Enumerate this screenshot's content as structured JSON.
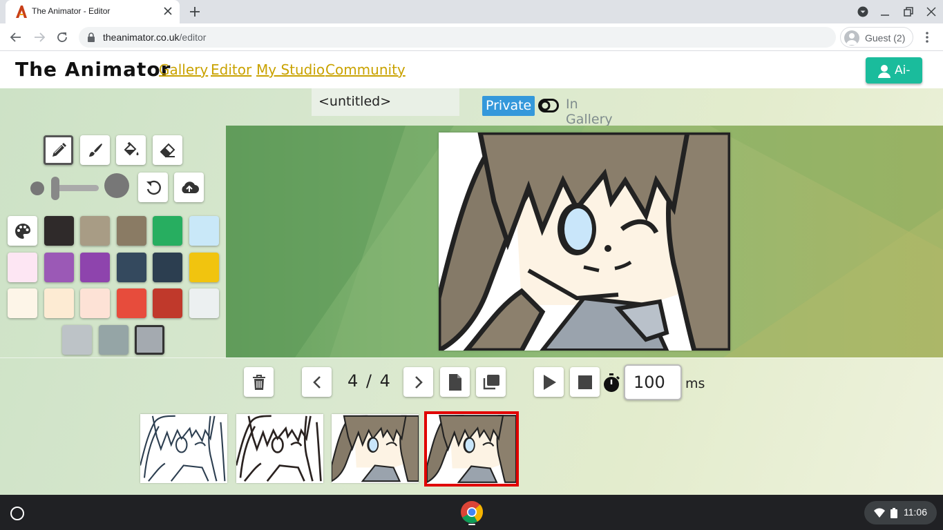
{
  "browser": {
    "tab_title": "The Animator - Editor",
    "url_domain": "theanimator.co.uk",
    "url_path": "/editor",
    "profile_label": "Guest (2)"
  },
  "site": {
    "logo": "The Animator",
    "nav": [
      "Gallery",
      "Editor",
      "My Studio",
      "Community"
    ],
    "user_button": "Ai-"
  },
  "editor": {
    "title": "<untitled>",
    "privacy_private": "Private",
    "privacy_gallery": "In Gallery",
    "frame_counter": "4 / 4",
    "delay_value": "100",
    "delay_unit": "ms",
    "current_frame": 4,
    "frame_count": 4
  },
  "palette": {
    "colors": [
      "#2f2a2a",
      "#a89c85",
      "#8a7b64",
      "#27ae60",
      "#c9e8f8",
      "#fde6f3",
      "#9b59b6",
      "#8e44ad",
      "#34495e",
      "#2c3e50",
      "#f1c40f",
      "#fdf5e8",
      "#fdebd3",
      "#fde2d6",
      "#e74c3c",
      "#c0392b",
      "#ecf0f1",
      "#bdc3c7",
      "#95a5a6",
      "#a4aab0"
    ],
    "selected_index": 19
  },
  "icons": {
    "pencil": "pencil-icon",
    "brush": "brush-icon",
    "fill": "paint-bucket-icon",
    "eraser": "eraser-icon",
    "undo": "undo-icon",
    "upload": "cloud-upload-icon",
    "palette": "palette-icon",
    "delete": "trash-icon",
    "prev": "chevron-left-icon",
    "next": "chevron-right-icon",
    "new": "new-frame-icon",
    "copy": "copy-frame-icon",
    "play": "play-icon",
    "stop": "stop-icon",
    "timer": "stopwatch-icon"
  },
  "system": {
    "time": "11:06"
  }
}
